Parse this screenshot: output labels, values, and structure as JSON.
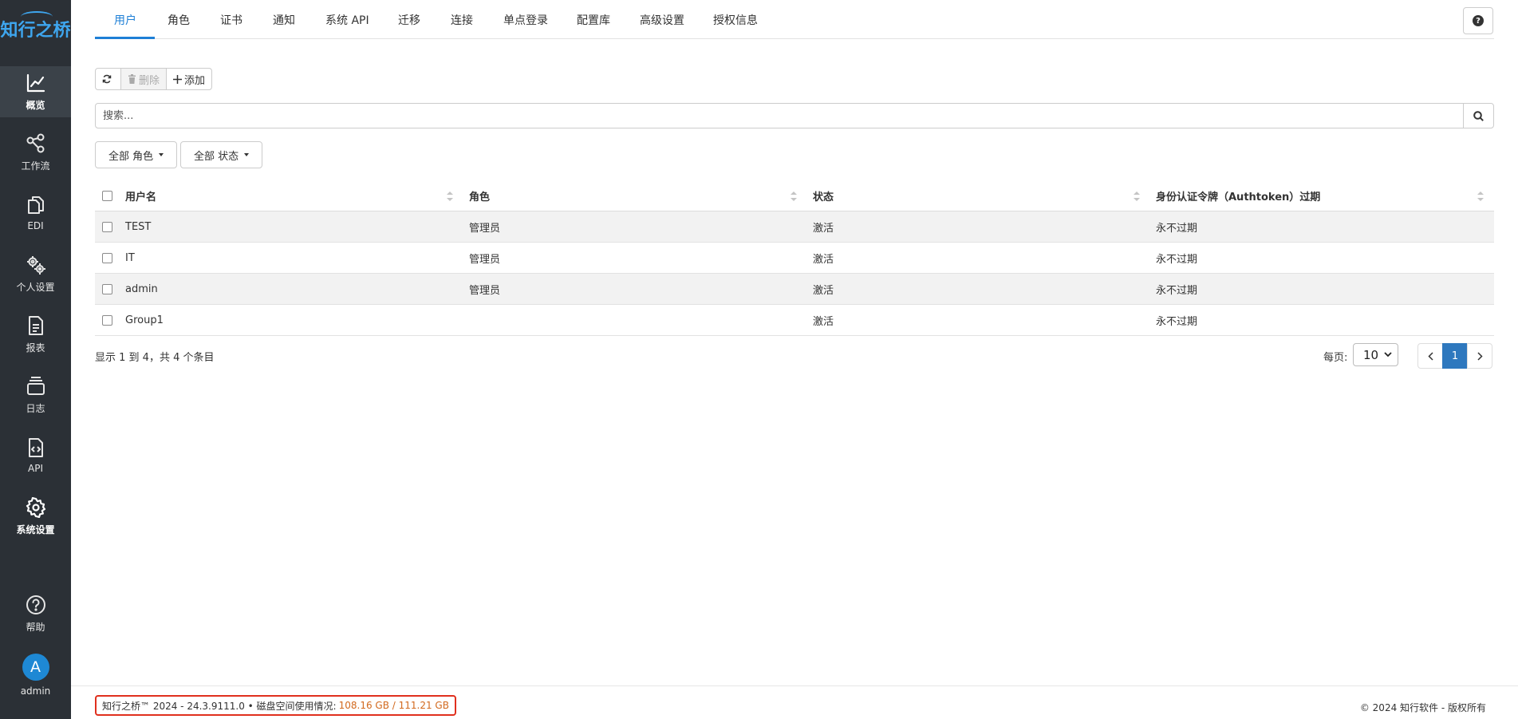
{
  "app": {
    "logo_text": "知行之桥"
  },
  "sidebar": {
    "items": [
      {
        "label": "概览",
        "icon": "chart-line-icon"
      },
      {
        "label": "工作流",
        "icon": "share-nodes-icon"
      },
      {
        "label": "EDI",
        "icon": "copy-files-icon"
      },
      {
        "label": "个人设置",
        "icon": "gears-icon"
      },
      {
        "label": "报表",
        "icon": "file-text-icon"
      },
      {
        "label": "日志",
        "icon": "layers-icon"
      },
      {
        "label": "API",
        "icon": "file-code-icon"
      },
      {
        "label": "系统设置",
        "icon": "gear-icon"
      }
    ],
    "help_label": "帮助",
    "user": {
      "initial": "A",
      "name": "admin"
    }
  },
  "tabs": [
    {
      "label": "用户",
      "active": true
    },
    {
      "label": "角色"
    },
    {
      "label": "证书"
    },
    {
      "label": "通知"
    },
    {
      "label": "系统 API"
    },
    {
      "label": "迁移"
    },
    {
      "label": "连接"
    },
    {
      "label": "单点登录"
    },
    {
      "label": "配置库"
    },
    {
      "label": "高级设置"
    },
    {
      "label": "授权信息"
    }
  ],
  "toolbar": {
    "delete_label": "删除",
    "add_label": "添加"
  },
  "search": {
    "placeholder": "搜索..."
  },
  "filters": {
    "role_label": "全部 角色",
    "status_label": "全部 状态"
  },
  "table": {
    "columns": [
      "用户名",
      "角色",
      "状态",
      "身份认证令牌（Authtoken）过期"
    ],
    "rows": [
      {
        "username": "TEST",
        "role": "管理员",
        "status": "激活",
        "expiry": "永不过期"
      },
      {
        "username": "IT",
        "role": "管理员",
        "status": "激活",
        "expiry": "永不过期"
      },
      {
        "username": "admin",
        "role": "管理员",
        "status": "激活",
        "expiry": "永不过期"
      },
      {
        "username": "Group1",
        "role": "",
        "status": "激活",
        "expiry": "永不过期"
      }
    ]
  },
  "pagination": {
    "info": "显示 1 到 4，共 4 个条目",
    "per_page_label": "每页:",
    "per_page_value": "10",
    "current_page": "1"
  },
  "footer": {
    "version": "知行之桥™ 2024 - 24.3.9111.0  •  磁盘空间使用情况:",
    "disk": "108.16 GB / 111.21 GB",
    "copyright": "© 2024 知行软件 - 版权所有"
  },
  "colors": {
    "accent": "#1e7fd6",
    "sidebar_bg": "#2b3036",
    "highlight_border": "#e0301e"
  }
}
